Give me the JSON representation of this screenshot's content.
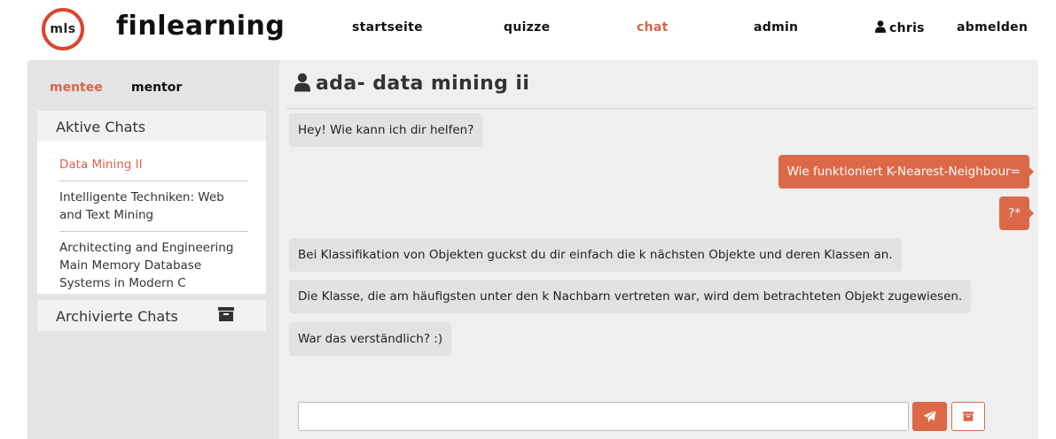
{
  "brand": {
    "logo_text": "mls",
    "name": "finlearning"
  },
  "nav": {
    "home": "startseite",
    "quizzes": "quizze",
    "chat": "chat",
    "admin": "admin",
    "user": "chris",
    "logout": "abmelden"
  },
  "sidebar": {
    "tabs": {
      "mentee": "mentee",
      "mentor": "mentor"
    },
    "active_header": "Aktive Chats",
    "active_chats": [
      {
        "label": "Data Mining II"
      },
      {
        "label": "Intelligente Techniken: Web and Text Mining"
      },
      {
        "label": "Architecting and Engineering Main Memory Database Systems in Modern C"
      }
    ],
    "archived_header": "Archivierte Chats"
  },
  "chat": {
    "title": "ada- data mining ii",
    "messages": [
      {
        "side": "in",
        "text": "Hey! Wie kann ich dir helfen?"
      },
      {
        "side": "out",
        "text": "Wie funktioniert K-Nearest-Neighbour="
      },
      {
        "side": "out",
        "text": "?*"
      },
      {
        "side": "in",
        "text": "Bei Klassifikation von Objekten guckst du dir einfach die k nächsten Objekte und deren Klassen an."
      },
      {
        "side": "in",
        "text": "Die Klasse, die am häufigsten unter den k Nachbarn vertreten war, wird dem betrachteten Objekt zugewiesen."
      },
      {
        "side": "in",
        "text": "War das verständlich? :)"
      }
    ],
    "input_value": ""
  },
  "colors": {
    "accent": "#dd6847",
    "logo_ring": "#d9462f"
  },
  "icons": {
    "user": "user-icon",
    "archive": "archive-icon",
    "send": "paper-plane-icon"
  }
}
